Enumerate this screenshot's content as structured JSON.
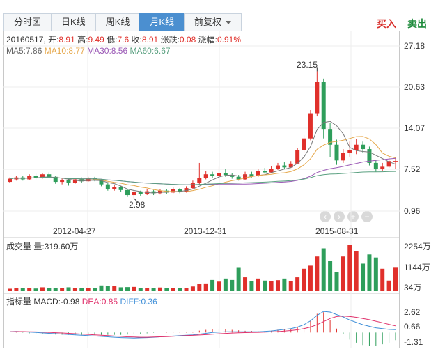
{
  "tabs": [
    {
      "label": "分时图",
      "active": false
    },
    {
      "label": "日K线",
      "active": false
    },
    {
      "label": "周K线",
      "active": false
    },
    {
      "label": "月K线",
      "active": true
    },
    {
      "label": "前复权",
      "active": false,
      "dropdown": true
    }
  ],
  "actions": {
    "buy": "买入",
    "sell": "卖出"
  },
  "info": {
    "date": "20160517",
    "open_label": "开:",
    "open": "8.91",
    "high_label": "高:",
    "high": "9.49",
    "low_label": "低:",
    "low": "7.6",
    "close_label": "收:",
    "close": "8.91",
    "change_label": "涨跌:",
    "change": "0.08",
    "pct_label": "涨幅:",
    "pct": "0.91%"
  },
  "ma": {
    "ma5": "MA5:7.86",
    "ma10": "MA10:8.77",
    "ma30": "MA30:8.56",
    "ma60": "MA60:6.67"
  },
  "price_axis": [
    "27.18",
    "20.63",
    "14.07",
    "7.52",
    "0.96"
  ],
  "date_axis": [
    "2012-04-27",
    "2013-12-31",
    "2015-08-31"
  ],
  "callouts": {
    "high": "23.15",
    "low": "2.98"
  },
  "volume": {
    "label": "成交量 量:319.60万",
    "axis": [
      "2254万",
      "1144万",
      "34万"
    ]
  },
  "indicator": {
    "label": "指标量",
    "macd": "MACD:-0.98",
    "dea": "DEA:0.85",
    "diff": "DIFF:0.36",
    "axis": [
      "2.62",
      "0.66",
      "-1.31"
    ]
  },
  "nav_icons": [
    "arrow-left-icon",
    "arrow-right-icon",
    "zoom-in-icon",
    "zoom-out-icon"
  ],
  "colors": {
    "up": "#e0302b",
    "down": "#2e9e5b",
    "accent": "#4b8fd0",
    "macd": "#e0306b",
    "dea": "#3f8fd8"
  },
  "chart_data": {
    "type": "candlestick",
    "x_labels": [
      "2012-04-27",
      "2013-12-31",
      "2015-08-31"
    ],
    "ylim": [
      0.96,
      27.18
    ],
    "candles": [
      {
        "o": 5.6,
        "c": 6.1,
        "h": 6.3,
        "l": 5.4
      },
      {
        "o": 6.0,
        "c": 6.3,
        "h": 6.5,
        "l": 5.8
      },
      {
        "o": 6.3,
        "c": 6.0,
        "h": 6.6,
        "l": 5.8
      },
      {
        "o": 6.0,
        "c": 6.5,
        "h": 6.8,
        "l": 5.9
      },
      {
        "o": 6.5,
        "c": 6.2,
        "h": 6.9,
        "l": 6.0
      },
      {
        "o": 6.2,
        "c": 6.8,
        "h": 7.0,
        "l": 6.1
      },
      {
        "o": 6.8,
        "c": 6.4,
        "h": 7.1,
        "l": 6.2
      },
      {
        "o": 6.4,
        "c": 5.6,
        "h": 6.6,
        "l": 5.3
      },
      {
        "o": 5.6,
        "c": 5.9,
        "h": 6.1,
        "l": 5.2
      },
      {
        "o": 5.9,
        "c": 5.4,
        "h": 6.0,
        "l": 5.0
      },
      {
        "o": 5.4,
        "c": 6.0,
        "h": 6.2,
        "l": 5.3
      },
      {
        "o": 6.0,
        "c": 5.7,
        "h": 6.3,
        "l": 5.5
      },
      {
        "o": 5.7,
        "c": 6.2,
        "h": 6.4,
        "l": 5.6
      },
      {
        "o": 6.2,
        "c": 5.9,
        "h": 6.4,
        "l": 5.7
      },
      {
        "o": 5.9,
        "c": 5.2,
        "h": 6.0,
        "l": 4.9
      },
      {
        "o": 5.2,
        "c": 4.5,
        "h": 5.4,
        "l": 4.2
      },
      {
        "o": 4.5,
        "c": 4.8,
        "h": 5.1,
        "l": 4.2
      },
      {
        "o": 4.8,
        "c": 4.3,
        "h": 5.0,
        "l": 4.0
      },
      {
        "o": 4.3,
        "c": 3.5,
        "h": 4.5,
        "l": 3.2
      },
      {
        "o": 3.5,
        "c": 4.0,
        "h": 4.3,
        "l": 2.98
      },
      {
        "o": 4.0,
        "c": 3.7,
        "h": 4.2,
        "l": 3.4
      },
      {
        "o": 3.7,
        "c": 4.1,
        "h": 4.4,
        "l": 3.5
      },
      {
        "o": 4.1,
        "c": 3.8,
        "h": 4.3,
        "l": 3.5
      },
      {
        "o": 3.8,
        "c": 4.2,
        "h": 4.5,
        "l": 3.6
      },
      {
        "o": 4.2,
        "c": 3.9,
        "h": 4.4,
        "l": 3.7
      },
      {
        "o": 3.9,
        "c": 4.4,
        "h": 4.7,
        "l": 3.8
      },
      {
        "o": 4.4,
        "c": 4.0,
        "h": 4.6,
        "l": 3.8
      },
      {
        "o": 4.0,
        "c": 4.6,
        "h": 4.9,
        "l": 3.9
      },
      {
        "o": 4.6,
        "c": 5.4,
        "h": 5.8,
        "l": 4.5
      },
      {
        "o": 5.4,
        "c": 6.2,
        "h": 8.6,
        "l": 5.2
      },
      {
        "o": 6.2,
        "c": 6.8,
        "h": 7.3,
        "l": 6.0
      },
      {
        "o": 6.8,
        "c": 6.5,
        "h": 7.2,
        "l": 6.2
      },
      {
        "o": 6.5,
        "c": 7.0,
        "h": 8.0,
        "l": 6.3
      },
      {
        "o": 7.0,
        "c": 6.7,
        "h": 7.6,
        "l": 6.4
      },
      {
        "o": 6.7,
        "c": 6.4,
        "h": 7.0,
        "l": 6.1
      },
      {
        "o": 6.4,
        "c": 6.0,
        "h": 6.7,
        "l": 5.8
      },
      {
        "o": 6.0,
        "c": 6.8,
        "h": 7.2,
        "l": 5.9
      },
      {
        "o": 6.8,
        "c": 6.5,
        "h": 7.2,
        "l": 6.3
      },
      {
        "o": 6.5,
        "c": 7.3,
        "h": 7.6,
        "l": 6.4
      },
      {
        "o": 7.3,
        "c": 7.1,
        "h": 7.8,
        "l": 6.9
      },
      {
        "o": 7.1,
        "c": 7.6,
        "h": 8.1,
        "l": 7.0
      },
      {
        "o": 7.6,
        "c": 8.2,
        "h": 8.6,
        "l": 7.5
      },
      {
        "o": 8.2,
        "c": 7.9,
        "h": 8.7,
        "l": 7.7
      },
      {
        "o": 7.9,
        "c": 8.5,
        "h": 8.9,
        "l": 7.8
      },
      {
        "o": 8.5,
        "c": 10.6,
        "h": 11.0,
        "l": 8.4
      },
      {
        "o": 10.6,
        "c": 12.5,
        "h": 13.0,
        "l": 10.2
      },
      {
        "o": 12.5,
        "c": 16.5,
        "h": 17.0,
        "l": 12.2
      },
      {
        "o": 16.5,
        "c": 21.5,
        "h": 23.15,
        "l": 16.0
      },
      {
        "o": 21.5,
        "c": 14.0,
        "h": 22.0,
        "l": 12.5
      },
      {
        "o": 14.0,
        "c": 11.5,
        "h": 15.0,
        "l": 9.5
      },
      {
        "o": 11.5,
        "c": 9.0,
        "h": 12.3,
        "l": 8.3
      },
      {
        "o": 9.0,
        "c": 10.2,
        "h": 10.8,
        "l": 8.6
      },
      {
        "o": 10.2,
        "c": 10.6,
        "h": 12.0,
        "l": 9.6
      },
      {
        "o": 10.6,
        "c": 11.5,
        "h": 12.4,
        "l": 10.0
      },
      {
        "o": 11.5,
        "c": 10.8,
        "h": 12.0,
        "l": 10.2
      },
      {
        "o": 10.8,
        "c": 8.6,
        "h": 11.2,
        "l": 8.2
      },
      {
        "o": 8.6,
        "c": 7.6,
        "h": 9.0,
        "l": 7.2
      },
      {
        "o": 7.6,
        "c": 8.0,
        "h": 8.6,
        "l": 7.3
      },
      {
        "o": 8.0,
        "c": 8.9,
        "h": 9.6,
        "l": 7.8
      },
      {
        "o": 8.83,
        "c": 8.91,
        "h": 9.49,
        "l": 7.6
      }
    ],
    "volume": [
      120,
      160,
      150,
      140,
      130,
      190,
      150,
      170,
      140,
      190,
      150,
      140,
      170,
      150,
      280,
      260,
      240,
      190,
      200,
      210,
      150,
      150,
      170,
      180,
      150,
      160,
      150,
      160,
      230,
      350,
      380,
      550,
      470,
      620,
      550,
      1144,
      680,
      480,
      620,
      520,
      480,
      540,
      620,
      500,
      680,
      1100,
      1250,
      1700,
      2100,
      1500,
      950,
      1700,
      2254,
      1950,
      1350,
      1800,
      1650,
      1100,
      520,
      480,
      700,
      1150,
      320
    ],
    "macd": {
      "diff": [
        0.1,
        0.15,
        0.1,
        0.05,
        0.0,
        -0.05,
        -0.1,
        -0.15,
        -0.2,
        -0.25,
        -0.3,
        -0.35,
        -0.4,
        -0.45,
        -0.5,
        -0.55,
        -0.6,
        -0.65,
        -0.68,
        -0.7,
        -0.68,
        -0.65,
        -0.6,
        -0.55,
        -0.5,
        -0.45,
        -0.4,
        -0.35,
        -0.3,
        -0.2,
        -0.1,
        0.0,
        0.05,
        0.1,
        0.1,
        0.1,
        0.1,
        0.1,
        0.1,
        0.15,
        0.2,
        0.3,
        0.4,
        0.5,
        0.7,
        1.0,
        1.5,
        2.2,
        2.7,
        2.62,
        2.3,
        2.0,
        1.6,
        1.3,
        1.0,
        0.8,
        0.6,
        0.5,
        0.4,
        0.36
      ],
      "dea": [
        0.1,
        0.12,
        0.12,
        0.1,
        0.08,
        0.05,
        0.02,
        -0.02,
        -0.06,
        -0.1,
        -0.15,
        -0.2,
        -0.25,
        -0.3,
        -0.35,
        -0.4,
        -0.45,
        -0.5,
        -0.55,
        -0.58,
        -0.6,
        -0.6,
        -0.58,
        -0.55,
        -0.52,
        -0.48,
        -0.44,
        -0.4,
        -0.36,
        -0.32,
        -0.27,
        -0.21,
        -0.16,
        -0.11,
        -0.07,
        -0.04,
        -0.01,
        0.0,
        0.02,
        0.05,
        0.08,
        0.12,
        0.18,
        0.25,
        0.35,
        0.5,
        0.7,
        1.0,
        1.4,
        1.8,
        2.05,
        2.1,
        2.05,
        1.95,
        1.8,
        1.65,
        1.45,
        1.25,
        1.05,
        0.85
      ]
    }
  }
}
